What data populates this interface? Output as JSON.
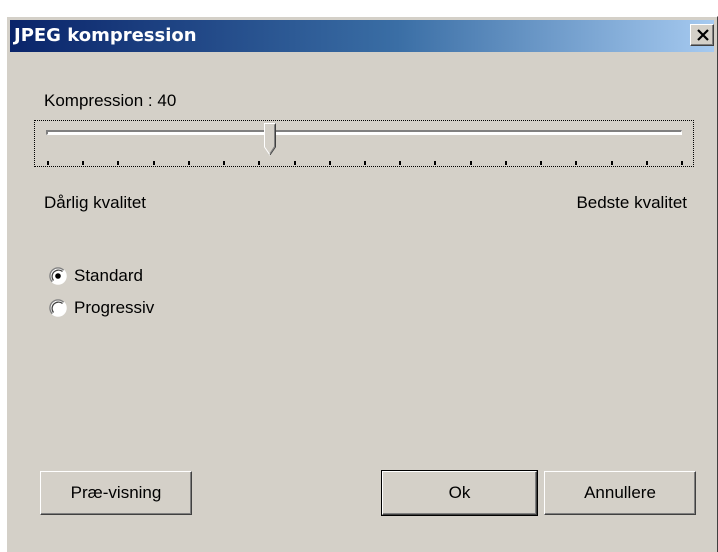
{
  "window": {
    "title": "JPEG kompression",
    "close_icon": "close-icon"
  },
  "compression": {
    "label_prefix": "Kompression : ",
    "value": "40",
    "slider_fraction": 0.35,
    "tick_count": 19,
    "low_label": "Dårlig kvalitet",
    "high_label": "Bedste kvalitet"
  },
  "mode": {
    "options": [
      {
        "label": "Standard",
        "selected": true
      },
      {
        "label": "Progressiv",
        "selected": false
      }
    ]
  },
  "buttons": {
    "preview": "Præ-visning",
    "ok": "Ok",
    "cancel": "Annullere"
  },
  "colors": {
    "titlebar_start": "#0a246a",
    "titlebar_end": "#a6caf0",
    "face": "#d4d0c8"
  }
}
